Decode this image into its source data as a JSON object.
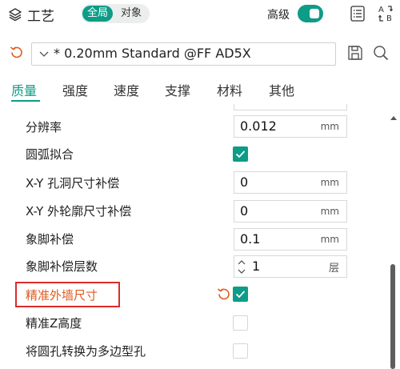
{
  "header": {
    "title": "工艺",
    "mode_global": "全局",
    "mode_object": "对象",
    "advanced_label": "高级",
    "advanced_on": true
  },
  "preset": {
    "value": "* 0.20mm Standard @FF AD5X"
  },
  "tabs": [
    {
      "label": "质量",
      "active": true
    },
    {
      "label": "强度",
      "active": false
    },
    {
      "label": "速度",
      "active": false
    },
    {
      "label": "支撑",
      "active": false
    },
    {
      "label": "材料",
      "active": false
    },
    {
      "label": "其他",
      "active": false
    }
  ],
  "settings": {
    "resolution": {
      "label": "分辨率",
      "value": "0.012",
      "unit": "mm"
    },
    "arc_fitting": {
      "label": "圆弧拟合",
      "checked": true
    },
    "xy_hole_comp": {
      "label": "X-Y 孔洞尺寸补偿",
      "value": "0",
      "unit": "mm"
    },
    "xy_contour_comp": {
      "label": "X-Y 外轮廓尺寸补偿",
      "value": "0",
      "unit": "mm"
    },
    "elephant_foot": {
      "label": "象脚补偿",
      "value": "0.1",
      "unit": "mm"
    },
    "elephant_foot_layers": {
      "label": "象脚补偿层数",
      "value": "1",
      "unit": "层"
    },
    "precise_wall": {
      "label": "精准外墙尺寸",
      "checked": true,
      "modified": true
    },
    "precise_z": {
      "label": "精准Z高度",
      "checked": false
    },
    "holes_to_polyholes": {
      "label": "将圆孔转换为多边型孔",
      "checked": false
    }
  },
  "colors": {
    "accent": "#0d9c87",
    "modified": "#e05a1e",
    "highlight_box": "#dc2b2b"
  }
}
